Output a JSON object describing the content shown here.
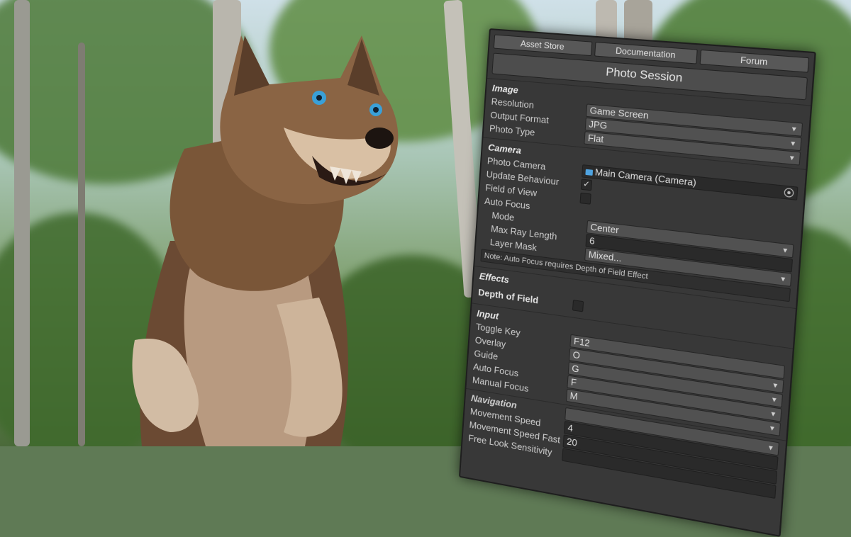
{
  "toolbar": {
    "asset_store": "Asset Store",
    "documentation": "Documentation",
    "forum": "Forum"
  },
  "title_button": "Photo Session",
  "image": {
    "title": "Image",
    "resolution_label": "Resolution",
    "resolution_value": "Game Screen",
    "output_format_label": "Output Format",
    "output_format_value": "JPG",
    "photo_type_label": "Photo Type",
    "photo_type_value": "Flat"
  },
  "camera": {
    "title": "Camera",
    "photo_camera_label": "Photo Camera",
    "photo_camera_value": "Main Camera (Camera)",
    "update_behaviour_label": "Update Behaviour",
    "update_behaviour_checked": true,
    "check_glyph": "✓",
    "field_of_view_label": "Field of View",
    "field_of_view_checked": false,
    "auto_focus_label": "Auto Focus",
    "mode_label": "Mode",
    "mode_value": "Center",
    "max_ray_length_label": "Max Ray Length",
    "max_ray_length_value": "6",
    "layer_mask_label": "Layer Mask",
    "layer_mask_value": "Mixed...",
    "note": "Note: Auto Focus requires Depth of Field Effect"
  },
  "effects": {
    "title": "Effects",
    "depth_of_field_label": "Depth of Field",
    "depth_of_field_checked": false
  },
  "input": {
    "title": "Input",
    "toggle_key_label": "Toggle Key",
    "toggle_key_value": "F12",
    "overlay_label": "Overlay",
    "overlay_value": "O",
    "guide_label": "Guide",
    "guide_value": "G",
    "auto_focus_label": "Auto Focus",
    "auto_focus_value": "F",
    "manual_focus_label": "Manual Focus",
    "manual_focus_value": "M"
  },
  "navigation": {
    "title": "Navigation",
    "movement_speed_label": "Movement Speed",
    "movement_speed_value": "4",
    "movement_speed_fast_label": "Movement Speed Fast",
    "movement_speed_fast_value": "20",
    "free_look_label": "Free Look Sensitivity"
  },
  "icons": {
    "dropdown": "chevron-down-icon",
    "camera_object": "camera-object-icon",
    "object_picker": "object-picker-icon"
  }
}
